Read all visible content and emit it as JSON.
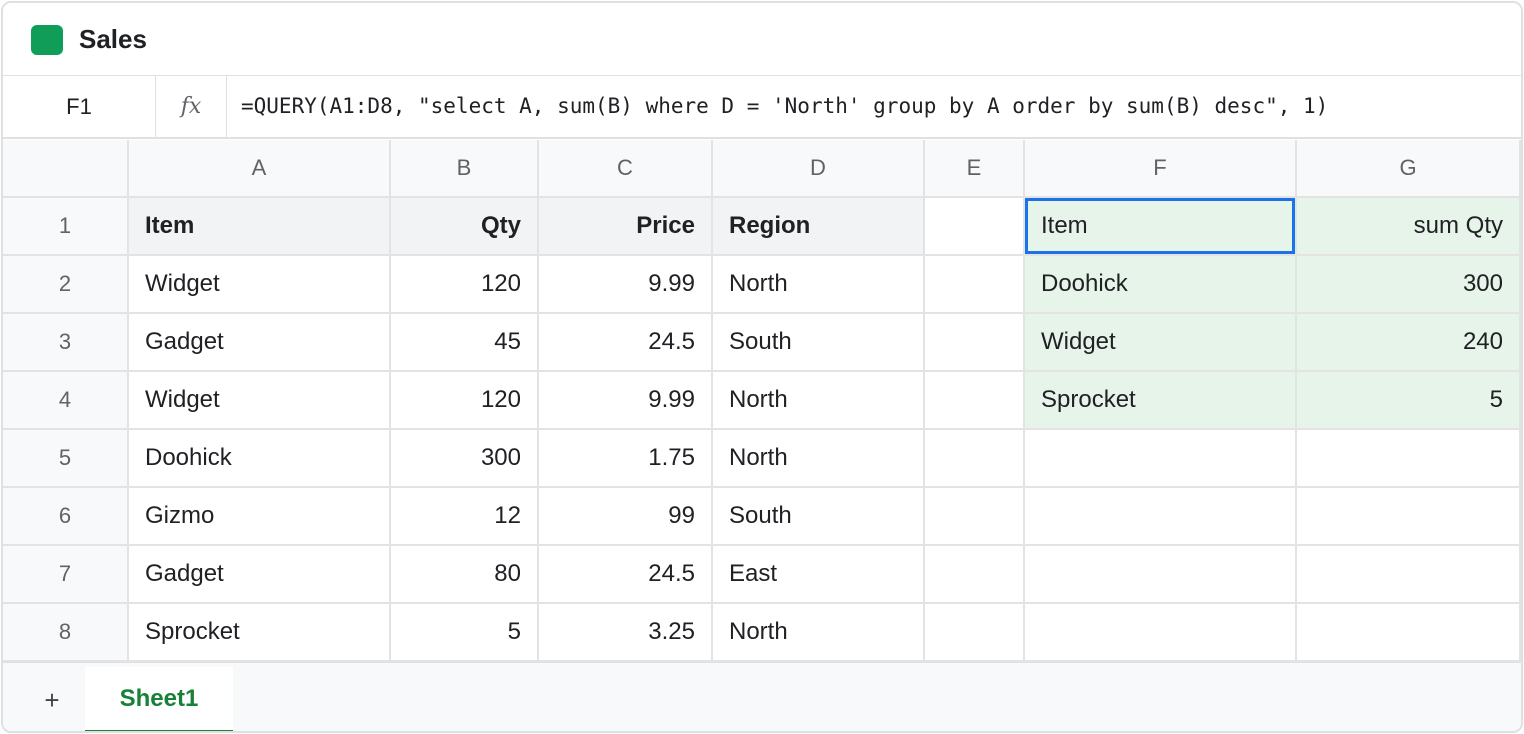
{
  "app": {
    "title": "Sales",
    "brand_color": "#0f9d58"
  },
  "formula_bar": {
    "cell_ref": "F1",
    "fx_label": "fx",
    "formula": "=QUERY(A1:D8, \"select A, sum(B) where D = 'North' group by A order by sum(B) desc\", 1)"
  },
  "grid": {
    "columns": [
      "A",
      "B",
      "C",
      "D",
      "E",
      "F",
      "G"
    ],
    "rows": [
      {
        "num": "1",
        "cells": [
          "Item",
          "Qty",
          "Price",
          "Region",
          "",
          "Item",
          "sum Qty"
        ]
      },
      {
        "num": "2",
        "cells": [
          "Widget",
          "120",
          "9.99",
          "North",
          "",
          "Doohick",
          "300"
        ]
      },
      {
        "num": "3",
        "cells": [
          "Gadget",
          "45",
          "24.5",
          "South",
          "",
          "Widget",
          "240"
        ]
      },
      {
        "num": "4",
        "cells": [
          "Widget",
          "120",
          "9.99",
          "North",
          "",
          "Sprocket",
          "5"
        ]
      },
      {
        "num": "5",
        "cells": [
          "Doohick",
          "300",
          "1.75",
          "North",
          "",
          "",
          ""
        ]
      },
      {
        "num": "6",
        "cells": [
          "Gizmo",
          "12",
          "99",
          "South",
          "",
          "",
          ""
        ]
      },
      {
        "num": "7",
        "cells": [
          "Gadget",
          "80",
          "24.5",
          "East",
          "",
          "",
          ""
        ]
      },
      {
        "num": "8",
        "cells": [
          "Sprocket",
          "5",
          "3.25",
          "North",
          "",
          "",
          ""
        ]
      }
    ],
    "selected_cell": "F1",
    "selection_color": "#1a73e8",
    "result_fill_color": "#e6f4ea"
  },
  "sheets": {
    "add_label": "+",
    "tabs": [
      {
        "label": "Sheet1",
        "active": true
      }
    ],
    "active_color": "#188038"
  }
}
